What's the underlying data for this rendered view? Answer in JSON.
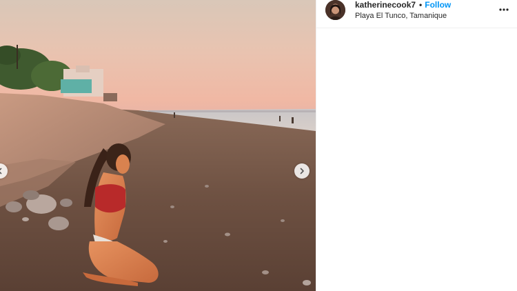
{
  "post": {
    "username": "katherinecook7",
    "separator": "•",
    "follow_label": "Follow",
    "location": "Playa El Tunco, Tamanique"
  },
  "icons": {
    "more": "more-options-icon",
    "next": "chevron-right-icon",
    "prev": "chevron-left-icon"
  },
  "colors": {
    "follow": "#0095f6",
    "text": "#262626"
  }
}
